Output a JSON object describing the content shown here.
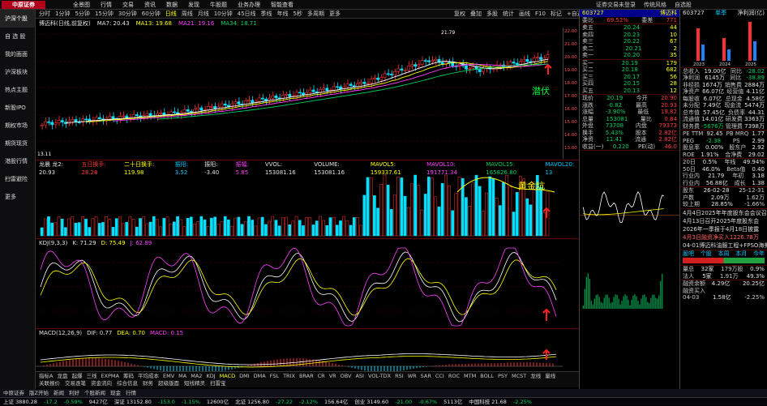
{
  "app": {
    "logo": "中原证券",
    "menu": [
      "全景图",
      "行情",
      "交易",
      "资讯",
      "数据",
      "发现",
      "牛股题",
      "业务办理",
      "智能查看"
    ],
    "right": [
      "证券交易未登录",
      "传统风格",
      "自选股"
    ]
  },
  "sidebar": [
    "沪深个股",
    "自 选 股",
    "我的面面",
    "沪深板块",
    "热点主题",
    "新股IPO",
    "期权市场",
    "期货现货",
    "港股行情",
    "扫雷避险",
    "更多"
  ],
  "period_tabs": [
    "分时",
    "1分钟",
    "5分钟",
    "15分钟",
    "30分钟",
    "60分钟",
    "日线",
    "周线",
    "月线",
    "10分钟",
    "45日线",
    "季线",
    "年线",
    "5秒",
    "多周期",
    "更多"
  ],
  "period_active": "日线",
  "tools": [
    "复权",
    "叠加",
    "多股",
    "统计",
    "画线",
    "F10",
    "标记",
    "+自选",
    "返回"
  ],
  "stock": {
    "code": "603727",
    "name": "博迈科",
    "title": "博迈科(日线,前复权)"
  },
  "ma": {
    "ma7": "MA7: 20.43",
    "ma13": "MA13: 19.68",
    "ma21": "MA21: 19.16",
    "ma34": "MA34: 18.71"
  },
  "chart_data": {
    "type": "candlestick",
    "price_high": "21.79",
    "price_low": "13.11",
    "annotations": [
      "潜伏",
      "黄金坑"
    ],
    "yticks": [
      "22.00",
      "21.00",
      "20.00",
      "19.00",
      "18.00",
      "17.00",
      "16.00",
      "15.00",
      "14.00",
      "13.00"
    ],
    "vol_yticks": [
      "60000",
      "40000",
      "30000",
      "20000",
      "10000"
    ],
    "kdj_yticks": [
      "100",
      "80",
      "50",
      "20",
      "0"
    ],
    "macd_yticks": [
      "0.60",
      "0.40",
      "0.20",
      "0.00",
      "-0.20",
      "-0.40"
    ]
  },
  "vol_line": [
    "龙晨 龙2: 20.93",
    "五日换手: 28.28",
    "二十日换手: 119.98",
    "振阳: 3.52",
    "振阳: -3.40",
    "振幅: 5.85",
    "VVOL: 153081.16",
    "VOLUME: 153081.16",
    "MAVOL5: 159337.61",
    "MAVOL10: 191771.34",
    "MAVOL15: 165826.80",
    "MAVOL20: 13"
  ],
  "kdj_line": [
    "KDJ(9,3,3)",
    "K: 71.29",
    "D: 75.49",
    "J: 62.89"
  ],
  "macd_line": [
    "MACD(12,26,9)",
    "DIF: 0.77",
    "DEA: 0.70",
    "MACD: 0.15"
  ],
  "indicators": [
    "指标A",
    "龙盘",
    "起爆",
    "三线",
    "EXPMA",
    "筹码",
    "平均成本",
    "EMV",
    "MA",
    "MA2",
    "KDJ",
    "MACD",
    "DMI",
    "DMA",
    "FSL",
    "TRIX",
    "BRAR",
    "CR",
    "VR",
    "OBV",
    "ASI",
    "VOL-TDX",
    "RSI",
    "WR",
    "SAR",
    "CCI",
    "ROC",
    "MTM",
    "BOLL",
    "PSY",
    "MCST",
    "龙线",
    "量线"
  ],
  "indicator_active": "MACD",
  "bottom_tabs": [
    "关联报价",
    "交易逐笔",
    "资金流向",
    "综合信息",
    "财务",
    "超级版面",
    "短线精灵",
    "扫雷宝"
  ],
  "quote": {
    "weibi": "69.52%",
    "weicha": "771",
    "asks": [
      [
        "卖五",
        "20.24",
        "44"
      ],
      [
        "卖四",
        "20.23",
        "10"
      ],
      [
        "卖三",
        "20.22",
        "67"
      ],
      [
        "卖二",
        "20.21",
        "2"
      ],
      [
        "卖一",
        "20.20",
        "35"
      ]
    ],
    "bids": [
      [
        "买一",
        "20.19",
        "179"
      ],
      [
        "买二",
        "20.18",
        "682"
      ],
      [
        "买三",
        "20.17",
        "56"
      ],
      [
        "买四",
        "20.15",
        "28"
      ],
      [
        "买五",
        "20.13",
        "12"
      ]
    ],
    "rows": [
      [
        "现价",
        "20.19",
        "今开",
        "20.90"
      ],
      [
        "涨跌",
        "-0.82",
        "最高",
        "20.93"
      ],
      [
        "涨幅",
        "-3.90%",
        "最低",
        "19.82"
      ],
      [
        "总量",
        "153081",
        "量比",
        "0.84"
      ],
      [
        "外盘",
        "73708",
        "内盘",
        "79373"
      ],
      [
        "换手",
        "5.43%",
        "股本",
        "2.82亿"
      ],
      [
        "净资",
        "11.41",
        "流通",
        "2.82亿"
      ],
      [
        "收益(一)",
        "0.220",
        "PE(动)",
        "46.0"
      ]
    ]
  },
  "right": {
    "code": "603727",
    "tags": "单季",
    "ylabel": "净利润(亿)",
    "years": [
      "2023",
      "2024",
      "2025"
    ],
    "fin": [
      [
        "总收入",
        "19.00亿",
        "同比",
        "-28.02"
      ],
      [
        "净利润",
        "6145万",
        "同比",
        "-38.89"
      ],
      [
        "非经损",
        "1674万",
        "销售费",
        "2884万"
      ],
      [
        "净资产",
        "66.07亿",
        "经营值",
        "4.11亿"
      ],
      [
        "每股收",
        "6.07亿",
        "总现金",
        "4.58亿"
      ],
      [
        "未分配",
        "7.49亿",
        "现金流",
        "5474万"
      ],
      [
        "总市值",
        "57.45亿",
        "负债率",
        "44.31"
      ],
      [
        "流通值",
        "14.01亿",
        "研发费",
        "3363万"
      ],
      [
        "财务费",
        "-5676万",
        "管理费",
        "7398万"
      ]
    ],
    "val": [
      [
        "PE TTM",
        "92.45",
        "PB MRQ",
        "1.77"
      ],
      [
        "PEG",
        "-2.38",
        "PS",
        "2.99"
      ],
      [
        "股息率",
        "0.00%",
        "股东户",
        "2.92"
      ],
      [
        "ROE",
        "1.91%",
        "合净费",
        "29.02"
      ]
    ],
    "ratio": [
      [
        "20日",
        "0.5%",
        "年线",
        "49.94%"
      ],
      [
        "50日",
        "46.0%",
        "Beta值",
        "0.40"
      ],
      [
        "行业内",
        "21.79",
        "年初",
        "3.18"
      ],
      [
        "行业内",
        "56.88亿",
        "成长",
        "1.38"
      ]
    ],
    "events": [
      [
        "股东",
        "26-02-28",
        "25-12-31"
      ],
      [
        "户数",
        "2.09万",
        "1.62万"
      ],
      [
        "较上期",
        "28.85%",
        "-1.66%"
      ]
    ],
    "news": [
      "4月4日2025年年度股东会会议召...",
      "4月13日召开2025年度股东会",
      "2026年一季报于4月18日披露",
      "4月3日融资净买入1226.78万",
      "04-01博迈科油服工程+FPSO海美..."
    ],
    "flow_tabs": [
      "股吧",
      "个股",
      "本周",
      "本月",
      "今年"
    ],
    "stats": [
      [
        "量总",
        "32家",
        "179万股",
        "0.9%"
      ],
      [
        "法人",
        "5家",
        "1.91万",
        "49.3%"
      ]
    ],
    "bottom": [
      [
        "融资余额",
        "4.29亿",
        "",
        "20.25亿"
      ],
      [
        "融资买入",
        "",
        "",
        ""
      ],
      [
        "04-03",
        "1.58亿",
        "-2.25%"
      ]
    ]
  },
  "status": [
    "中原证券",
    "版Z开始",
    "新闻",
    "利好",
    "个股新闻",
    "现金",
    "行情"
  ],
  "ticker": [
    "上证 3880.28",
    "-17.2",
    "-0.59%",
    "9427亿",
    "深证 13152.80",
    "-153.0",
    "-1.15%",
    "12600亿",
    "北证 1256.80",
    "-27.22",
    "-2.12%",
    "156.64亿",
    "创业 3149.60",
    "-21.00",
    "-0.67%",
    "5113亿",
    "中国科技 21.68",
    "-2.25%"
  ]
}
